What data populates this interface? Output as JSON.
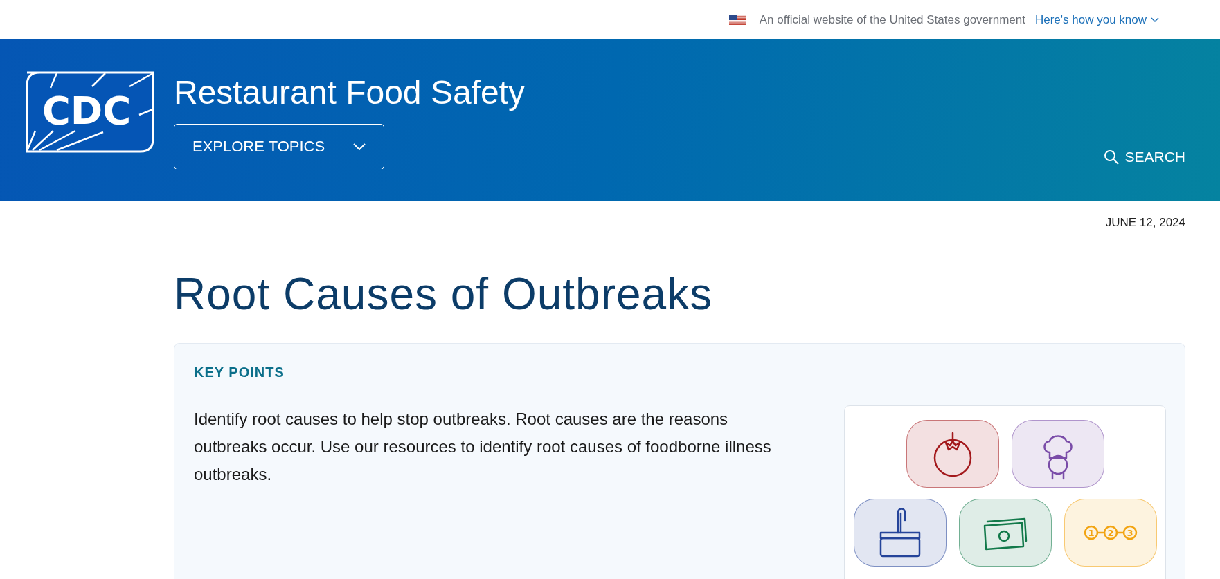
{
  "gov_banner": {
    "text": "An official website of the United States government",
    "link": "Here's how you know"
  },
  "header": {
    "logo": "CDC",
    "site_title": "Restaurant Food Safety",
    "explore_button": "EXPLORE TOPICS",
    "search_button": "SEARCH"
  },
  "date": "JUNE 12, 2024",
  "page_title": "Root Causes of Outbreaks",
  "key_points": {
    "heading": "KEY POINTS",
    "text": "Identify root causes to help stop outbreaks. Root causes are the reasons outbreaks occur. Use our resources to identify root causes of foodborne illness outbreaks.",
    "illustration": {
      "rows": [
        [
          {
            "kind": "tomato",
            "color": "#a3191c"
          },
          {
            "kind": "chef",
            "color": "#7a4ca8"
          }
        ],
        [
          {
            "kind": "sink",
            "color": "#25449a"
          },
          {
            "kind": "money",
            "color": "#12794a"
          },
          {
            "kind": "steps",
            "color": "#f2a412",
            "labels": [
              "1",
              "2",
              "3"
            ]
          }
        ]
      ]
    }
  }
}
